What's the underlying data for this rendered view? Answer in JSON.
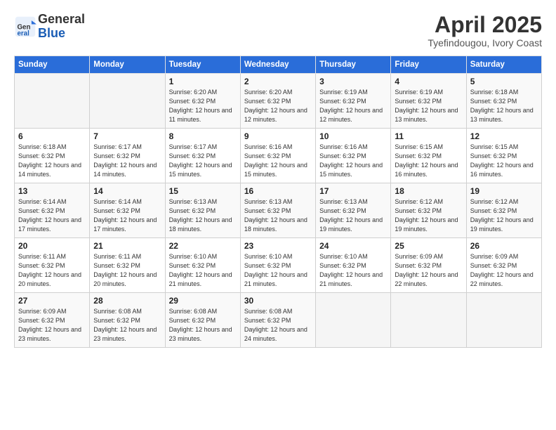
{
  "logo": {
    "text_general": "General",
    "text_blue": "Blue"
  },
  "header": {
    "title": "April 2025",
    "subtitle": "Tyefindougou, Ivory Coast"
  },
  "weekdays": [
    "Sunday",
    "Monday",
    "Tuesday",
    "Wednesday",
    "Thursday",
    "Friday",
    "Saturday"
  ],
  "weeks": [
    [
      {
        "day": "",
        "info": ""
      },
      {
        "day": "",
        "info": ""
      },
      {
        "day": "1",
        "info": "Sunrise: 6:20 AM\nSunset: 6:32 PM\nDaylight: 12 hours and 11 minutes."
      },
      {
        "day": "2",
        "info": "Sunrise: 6:20 AM\nSunset: 6:32 PM\nDaylight: 12 hours and 12 minutes."
      },
      {
        "day": "3",
        "info": "Sunrise: 6:19 AM\nSunset: 6:32 PM\nDaylight: 12 hours and 12 minutes."
      },
      {
        "day": "4",
        "info": "Sunrise: 6:19 AM\nSunset: 6:32 PM\nDaylight: 12 hours and 13 minutes."
      },
      {
        "day": "5",
        "info": "Sunrise: 6:18 AM\nSunset: 6:32 PM\nDaylight: 12 hours and 13 minutes."
      }
    ],
    [
      {
        "day": "6",
        "info": "Sunrise: 6:18 AM\nSunset: 6:32 PM\nDaylight: 12 hours and 14 minutes."
      },
      {
        "day": "7",
        "info": "Sunrise: 6:17 AM\nSunset: 6:32 PM\nDaylight: 12 hours and 14 minutes."
      },
      {
        "day": "8",
        "info": "Sunrise: 6:17 AM\nSunset: 6:32 PM\nDaylight: 12 hours and 15 minutes."
      },
      {
        "day": "9",
        "info": "Sunrise: 6:16 AM\nSunset: 6:32 PM\nDaylight: 12 hours and 15 minutes."
      },
      {
        "day": "10",
        "info": "Sunrise: 6:16 AM\nSunset: 6:32 PM\nDaylight: 12 hours and 15 minutes."
      },
      {
        "day": "11",
        "info": "Sunrise: 6:15 AM\nSunset: 6:32 PM\nDaylight: 12 hours and 16 minutes."
      },
      {
        "day": "12",
        "info": "Sunrise: 6:15 AM\nSunset: 6:32 PM\nDaylight: 12 hours and 16 minutes."
      }
    ],
    [
      {
        "day": "13",
        "info": "Sunrise: 6:14 AM\nSunset: 6:32 PM\nDaylight: 12 hours and 17 minutes."
      },
      {
        "day": "14",
        "info": "Sunrise: 6:14 AM\nSunset: 6:32 PM\nDaylight: 12 hours and 17 minutes."
      },
      {
        "day": "15",
        "info": "Sunrise: 6:13 AM\nSunset: 6:32 PM\nDaylight: 12 hours and 18 minutes."
      },
      {
        "day": "16",
        "info": "Sunrise: 6:13 AM\nSunset: 6:32 PM\nDaylight: 12 hours and 18 minutes."
      },
      {
        "day": "17",
        "info": "Sunrise: 6:13 AM\nSunset: 6:32 PM\nDaylight: 12 hours and 19 minutes."
      },
      {
        "day": "18",
        "info": "Sunrise: 6:12 AM\nSunset: 6:32 PM\nDaylight: 12 hours and 19 minutes."
      },
      {
        "day": "19",
        "info": "Sunrise: 6:12 AM\nSunset: 6:32 PM\nDaylight: 12 hours and 19 minutes."
      }
    ],
    [
      {
        "day": "20",
        "info": "Sunrise: 6:11 AM\nSunset: 6:32 PM\nDaylight: 12 hours and 20 minutes."
      },
      {
        "day": "21",
        "info": "Sunrise: 6:11 AM\nSunset: 6:32 PM\nDaylight: 12 hours and 20 minutes."
      },
      {
        "day": "22",
        "info": "Sunrise: 6:10 AM\nSunset: 6:32 PM\nDaylight: 12 hours and 21 minutes."
      },
      {
        "day": "23",
        "info": "Sunrise: 6:10 AM\nSunset: 6:32 PM\nDaylight: 12 hours and 21 minutes."
      },
      {
        "day": "24",
        "info": "Sunrise: 6:10 AM\nSunset: 6:32 PM\nDaylight: 12 hours and 21 minutes."
      },
      {
        "day": "25",
        "info": "Sunrise: 6:09 AM\nSunset: 6:32 PM\nDaylight: 12 hours and 22 minutes."
      },
      {
        "day": "26",
        "info": "Sunrise: 6:09 AM\nSunset: 6:32 PM\nDaylight: 12 hours and 22 minutes."
      }
    ],
    [
      {
        "day": "27",
        "info": "Sunrise: 6:09 AM\nSunset: 6:32 PM\nDaylight: 12 hours and 23 minutes."
      },
      {
        "day": "28",
        "info": "Sunrise: 6:08 AM\nSunset: 6:32 PM\nDaylight: 12 hours and 23 minutes."
      },
      {
        "day": "29",
        "info": "Sunrise: 6:08 AM\nSunset: 6:32 PM\nDaylight: 12 hours and 23 minutes."
      },
      {
        "day": "30",
        "info": "Sunrise: 6:08 AM\nSunset: 6:32 PM\nDaylight: 12 hours and 24 minutes."
      },
      {
        "day": "",
        "info": ""
      },
      {
        "day": "",
        "info": ""
      },
      {
        "day": "",
        "info": ""
      }
    ]
  ]
}
